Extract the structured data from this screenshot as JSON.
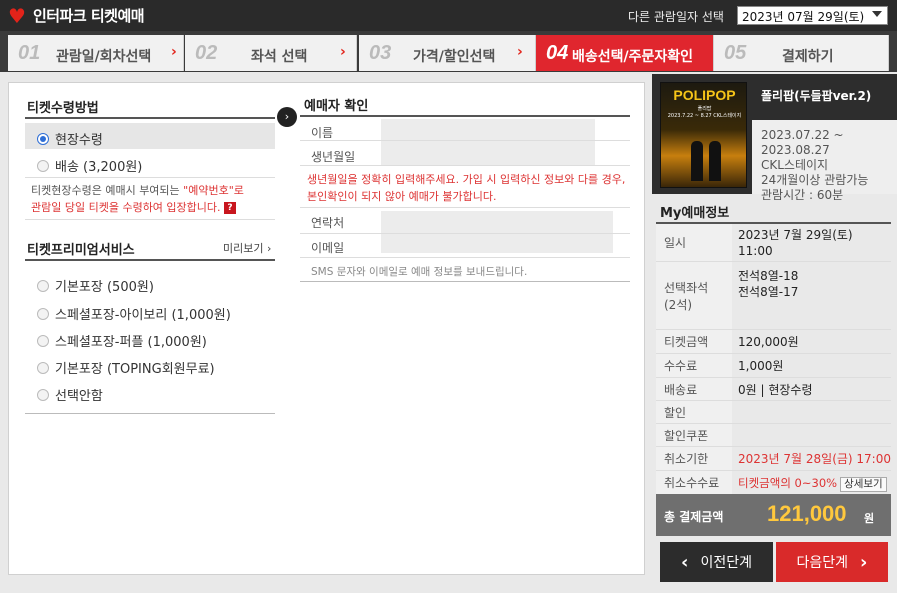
{
  "header": {
    "brand": "인터파크 티켓예매",
    "other_date_label": "다른 관람일자 선택",
    "selected_date": "2023년 07월 29일(토)"
  },
  "steps": [
    {
      "num": "01",
      "label": "관람일/회차선택"
    },
    {
      "num": "02",
      "label": "좌석 선택"
    },
    {
      "num": "03",
      "label": "가격/할인선택"
    },
    {
      "num": "04",
      "label": "배송선택/주문자확인"
    },
    {
      "num": "05",
      "label": "결제하기"
    }
  ],
  "ticket_method": {
    "title": "티켓수령방법",
    "options": [
      "현장수령",
      "배송 (3,200원)"
    ],
    "selected": "현장수령",
    "note_prefix": "티켓현장수령은 예매시 부여되는 ",
    "note_red": "\"예약번호\"로",
    "note_line2": "관람일 당일 티켓을 수령하여 입장합니다."
  },
  "premium": {
    "title": "티켓프리미엄서비스",
    "preview": "미리보기",
    "options": [
      "기본포장 (500원)",
      "스페셜포장-아이보리 (1,000원)",
      "스페셜포장-퍼플 (1,000원)",
      "기본포장 (TOPING회원무료)",
      "선택안함"
    ]
  },
  "booker": {
    "title": "예매자 확인",
    "name_label": "이름",
    "birth_label": "생년월일",
    "warning_line1": "생년월일을 정확히 입력해주세요. 가입 시 입력하신 정보와 다를 경우,",
    "warning_line2": "본인확인이 되지 않아 예매가 불가합니다.",
    "phone_label": "연락처",
    "email_label": "이메일",
    "sms_note": "SMS 문자와 이메일로 예매 정보를 보내드립니다."
  },
  "show": {
    "poster_title": "POLIPOP",
    "poster_sub": "폴리팝",
    "poster_caption": "2023.7.22 ~ 8.27 CKL스테이지",
    "title": "폴리팝(두들팝ver.2)",
    "period_start": "2023.07.22 ~",
    "period_end": "2023.08.27",
    "venue": "CKL스테이지",
    "age": "24개월이상 관람가능",
    "runtime": "관람시간 : 60분"
  },
  "my_booking": {
    "title": "My예매정보",
    "date_label": "일시",
    "date_value": "2023년 7월 29일(토)",
    "time_value": "11:00",
    "seat_label": "선택좌석",
    "seat_count": "(2석)",
    "seats": [
      "전석8열-18",
      "전석8열-17"
    ],
    "ticket_amount_label": "티켓금액",
    "ticket_amount": "120,000원",
    "fee_label": "수수료",
    "fee": "1,000원",
    "delivery_label": "배송료",
    "delivery": "0원 | 현장수령",
    "discount_label": "할인",
    "coupon_label": "할인쿠폰",
    "cancel_deadline_label": "취소기한",
    "cancel_deadline": "2023년 7월 28일(금) 17:00",
    "cancel_fee_label": "취소수수료",
    "cancel_fee": "티켓금액의 0~30%",
    "detail_button": "상세보기",
    "total_label": "총 결제금액",
    "total_value": "121,000",
    "total_unit": "원"
  },
  "buttons": {
    "prev": "이전단계",
    "next": "다음단계"
  },
  "colors": {
    "accent_red": "#e0262e",
    "top_bar": "#2a2a2a",
    "total_highlight": "#ffc83d"
  }
}
